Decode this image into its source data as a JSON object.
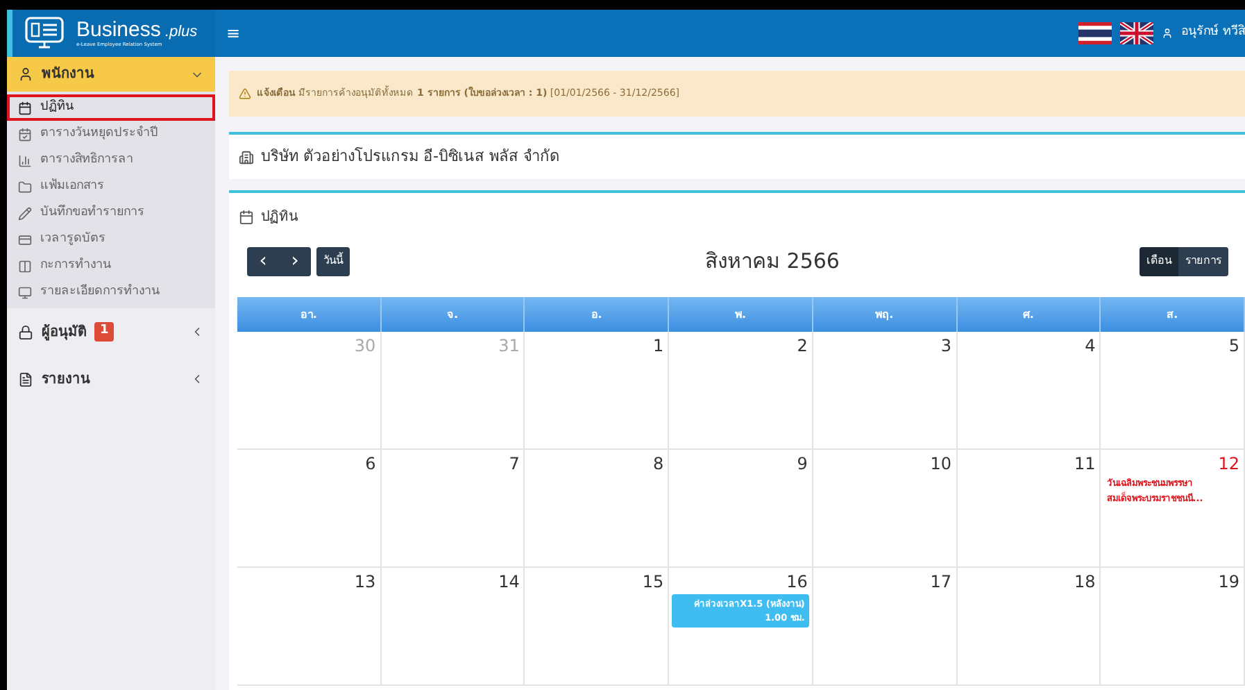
{
  "header": {
    "logo_title": "Business",
    "logo_suffix": ".plus",
    "logo_tagline": "e-Leave Employee Relation System",
    "menu_glyph": "≡",
    "user": "อนุรักษ์ ทวีสิ"
  },
  "sidebar": {
    "sections": [
      {
        "label": "พนักงาน",
        "kind": "user",
        "expanded": true,
        "items": [
          {
            "label": "ปฏิทิน",
            "kind": "calendar",
            "selected": true
          },
          {
            "label": "ตารางวันหยุดประจำปี",
            "kind": "calendar-check",
            "selected": false
          },
          {
            "label": "ตารางสิทธิการลา",
            "kind": "chart",
            "selected": false
          },
          {
            "label": "แฟ้มเอกสาร",
            "kind": "folder",
            "selected": false
          },
          {
            "label": "บันทึกขอทำรายการ",
            "kind": "pencil",
            "selected": false
          },
          {
            "label": "เวลารูดบัตร",
            "kind": "card",
            "selected": false
          },
          {
            "label": "กะการทำงาน",
            "kind": "columns",
            "selected": false
          },
          {
            "label": "รายละเอียดการทำงาน",
            "kind": "monitor",
            "selected": false
          }
        ]
      },
      {
        "label": "ผู้อนุมัติ",
        "kind": "lock",
        "expanded": false,
        "badge": "1"
      },
      {
        "label": "รายงาน",
        "kind": "file",
        "expanded": false
      }
    ]
  },
  "alert": {
    "label": "แจ้งเตือน",
    "text": "มีรายการค้างอนุมัติทั้งหมด **1 รายการ (ใบขอล่วงเวลา : 1)** [01/01/2566 - 31/12/2566]"
  },
  "company": {
    "name": "บริษัท ตัวอย่างโปรแกรม อี-บิซิเนส พลัส จำกัด"
  },
  "calendar": {
    "title": "ปฏิทิน",
    "prev": "‹",
    "next": "›",
    "today": "วันนี้",
    "month": "สิงหาคม 2566",
    "views": [
      {
        "label": "เดือน",
        "selected": true
      },
      {
        "label": "รายการ",
        "selected": false
      }
    ],
    "weekdays": [
      "อา.",
      "จ.",
      "อ.",
      "พ.",
      "พฤ.",
      "ศ.",
      "ส."
    ],
    "weeks": [
      [
        {
          "day": "30",
          "other_month": true
        },
        {
          "day": "31",
          "other_month": true
        },
        {
          "day": "1",
          "other_month": false
        },
        {
          "day": "2",
          "other_month": false
        },
        {
          "day": "3",
          "other_month": false
        },
        {
          "day": "4",
          "other_month": false
        },
        {
          "day": "5",
          "other_month": false
        }
      ],
      [
        {
          "day": "6",
          "other_month": false
        },
        {
          "day": "7",
          "other_month": false
        },
        {
          "day": "8",
          "other_month": false
        },
        {
          "day": "9",
          "other_month": false
        },
        {
          "day": "10",
          "other_month": false
        },
        {
          "day": "11",
          "other_month": false
        },
        {
          "day": "12",
          "other_month": false,
          "holiday": true,
          "events": [
            {
              "kind": "holiday",
              "text": "วันเฉลิมพระชนมพรรษา สมเด็จพระบรมราชชนนี..."
            }
          ]
        }
      ],
      [
        {
          "day": "13",
          "other_month": false
        },
        {
          "day": "14",
          "other_month": false
        },
        {
          "day": "15",
          "other_month": false
        },
        {
          "day": "16",
          "other_month": false,
          "events": [
            {
              "kind": "entry",
              "text": "ค่าล่วงเวลาX1.5 (หลังงาน)",
              "hours": "1.00 ชม."
            }
          ]
        },
        {
          "day": "17",
          "other_month": false
        },
        {
          "day": "18",
          "other_month": false
        },
        {
          "day": "19",
          "other_month": false
        }
      ]
    ]
  }
}
